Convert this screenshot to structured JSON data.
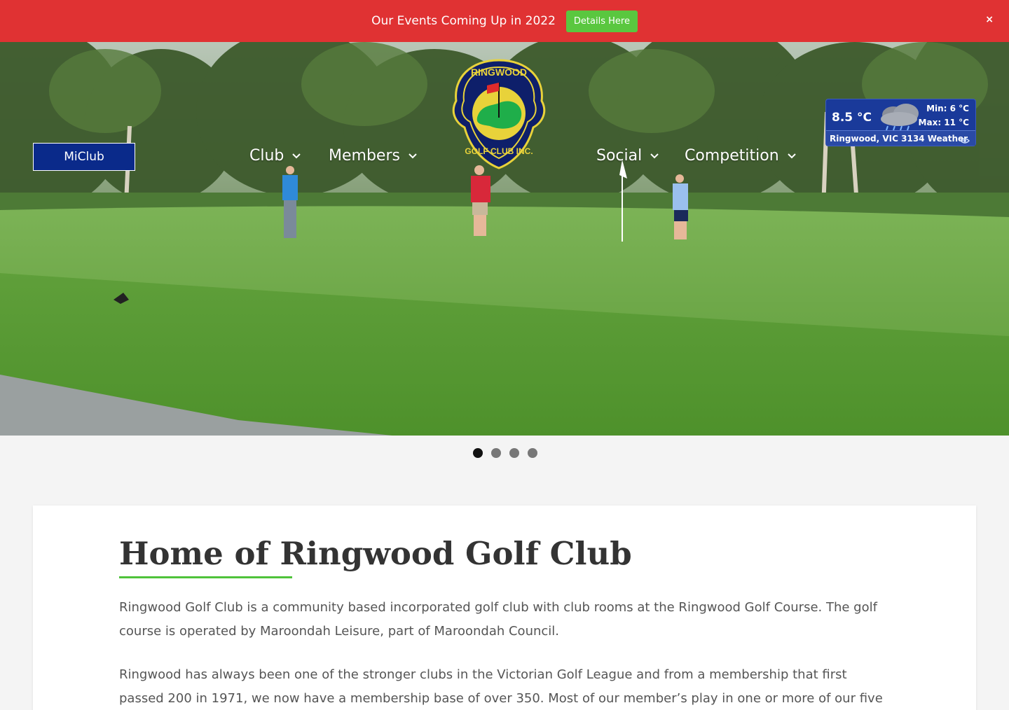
{
  "announcement": {
    "text": "Our Events Coming Up in 2022",
    "button_label": "Details Here",
    "close_label": "×"
  },
  "header": {
    "miclub_label": "MiClub",
    "nav": {
      "club": "Club",
      "members": "Members",
      "social": "Social",
      "competition": "Competition"
    },
    "chevron": "⌄"
  },
  "weather": {
    "temp": "8.5 °C",
    "min": "Min: 6 °C",
    "max": "Max: 11 °C",
    "location": "Ringwood, VIC 3134 Weather",
    "icon": "rain-cloud-icon"
  },
  "slider": {
    "count": 4,
    "active_index": 0
  },
  "content": {
    "title": "Home of Ringwood Golf Club",
    "paragraph1": "Ringwood Golf Club is a community based incorporated golf club with club rooms at the Ringwood Golf Course. The golf course is operated by Maroondah Leisure, part of Maroondah Council.",
    "paragraph2": "Ringwood has always been one of the stronger clubs in the Victorian Golf League and from a membership that first passed 200 in 1971, we now have a membership base of over 350.  Most of our member’s play in one or more of our five weekly club"
  },
  "colors": {
    "announcement_bg": "#e03233",
    "button_green": "#5ac73f",
    "miclub_blue": "#0a2a8a",
    "weather_blue": "#1a3a9a",
    "underline_green": "#4fc33a"
  }
}
